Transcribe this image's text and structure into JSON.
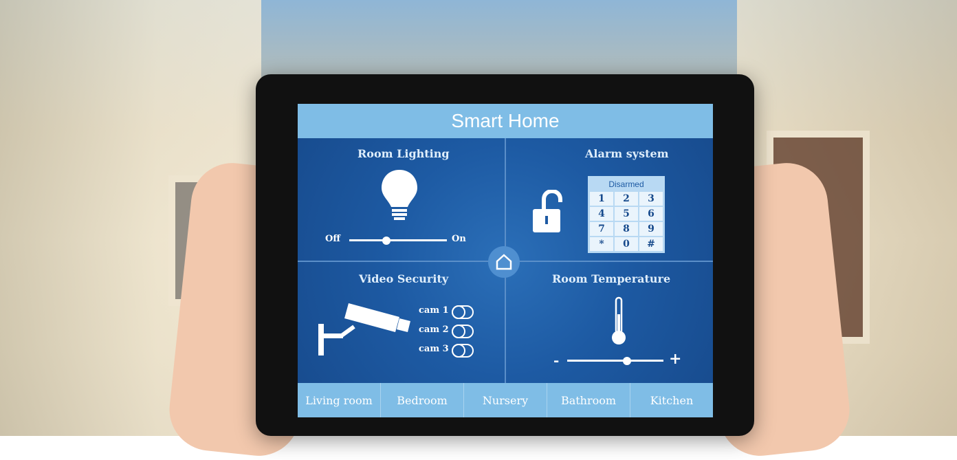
{
  "app": {
    "title": "Smart Home"
  },
  "panels": {
    "lighting": {
      "title": "Room Lighting",
      "off_label": "Off",
      "on_label": "On",
      "level": 0.4
    },
    "alarm": {
      "title": "Alarm system",
      "status": "Disarmed",
      "keys": [
        "1",
        "2",
        "3",
        "4",
        "5",
        "6",
        "7",
        "8",
        "9",
        "*",
        "0",
        "#"
      ]
    },
    "video": {
      "title": "Video Security",
      "cams": [
        {
          "label": "cam 1"
        },
        {
          "label": "cam 2"
        },
        {
          "label": "cam 3"
        }
      ]
    },
    "temperature": {
      "title": "Room Temperature",
      "minus": "-",
      "plus": "+",
      "level": 0.62
    }
  },
  "nav": {
    "items": [
      "Living room",
      "Bedroom",
      "Nursery",
      "Bathroom",
      "Kitchen"
    ]
  },
  "colors": {
    "accent": "#7fbde6",
    "panel": "#1d5aa3",
    "divider": "#5b8fc9"
  }
}
